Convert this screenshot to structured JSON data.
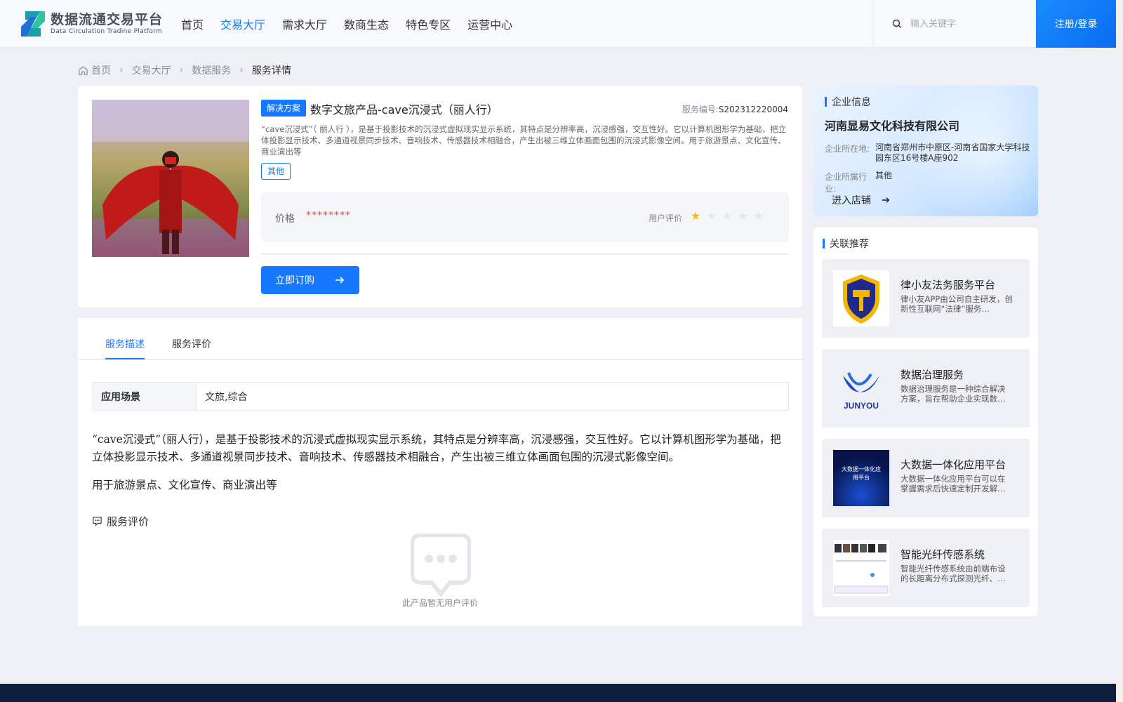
{
  "header": {
    "logo_cn": "数据流通交易平台",
    "logo_en": "Data Circulation Tradine Platform",
    "nav": [
      {
        "label": "首页",
        "active": false
      },
      {
        "label": "交易大厅",
        "active": true
      },
      {
        "label": "需求大厅",
        "active": false
      },
      {
        "label": "数商生态",
        "active": false
      },
      {
        "label": "特色专区",
        "active": false
      },
      {
        "label": "运营中心",
        "active": false
      }
    ],
    "search_placeholder": "输入关键字",
    "login_label": "注册/登录"
  },
  "breadcrumb": {
    "items": [
      "首页",
      "交易大厅",
      "数据服务"
    ],
    "current": "服务详情"
  },
  "product": {
    "tag": "解决方案",
    "title": "数字文旅产品-cave沉浸式（丽人行）",
    "code_label": "服务编号:",
    "code": "S202312220004",
    "summary": "“cave沉浸式”（ 丽人行 ），是基于投影技术的沉浸式虚拟现实显示系统，其特点是分辨率高，沉浸感强，交互性好。它以计算机图形学为基础，把立体投影显示技术、多通道视景同步技术、音响技术、传感器技术相融合，产生出被三维立体画面包围的沉浸式影像空间。用于旅游景点、文化宣传、商业演出等",
    "category_tag": "其他",
    "price_label": "价格",
    "price_value": "********",
    "rating_label": "用户评价",
    "rating": 1,
    "rating_max": 5,
    "buy_label": "立即订购"
  },
  "detail": {
    "tabs": [
      "服务描述",
      "服务评价"
    ],
    "active_tab": 0,
    "scene_label": "应用场景",
    "scene_value": "文旅,综合",
    "description_p1": "“cave沉浸式”（丽人行），是基于投影技术的沉浸式虚拟现实显示系统，其特点是分辨率高，沉浸感强，交互性好。它以计算机图形学为基础，把立体投影显示技术、多通道视景同步技术、音响技术、传感器技术相融合，产生出被三维立体画面包围的沉浸式影像空间。",
    "description_p2": "用于旅游景点、文化宣传、商业演出等",
    "review_title": "服务评价",
    "empty_text": "此产品暂无用户评价"
  },
  "company": {
    "section_title": "企业信息",
    "name": "河南显易文化科技有限公司",
    "location_label": "企业所在地:",
    "location": "河南省郑州市中原区-河南省国家大学科技园东区16号楼A座902",
    "industry_label": "企业所属行业:",
    "industry": "其他",
    "enter_label": "进入店铺"
  },
  "related": {
    "section_title": "关联推荐",
    "items": [
      {
        "title": "律小友法务服务平台",
        "desc": "律小友APP由公司自主研发，创新性互联网“法律”服务…"
      },
      {
        "title": "数据治理服务",
        "desc": "数据治理服务是一种综合解决方案，旨在帮助企业实现数…",
        "logo_text": "JUNYOU"
      },
      {
        "title": "大数据一体化应用平台",
        "desc": "大数据一体化应用平台可以在掌握需求后快速定制开发解…",
        "img_text": "大数据一体化应用平台"
      },
      {
        "title": "智能光纤传感系统",
        "desc": "智能光纤传感系统由前端布设的长距离分布式探测光纤、…"
      }
    ]
  },
  "colors": {
    "primary": "#1677ff",
    "price": "#f04848",
    "star_on": "#f7b52c",
    "star_off": "#e4e6eb",
    "footer": "#0f1e3c"
  }
}
